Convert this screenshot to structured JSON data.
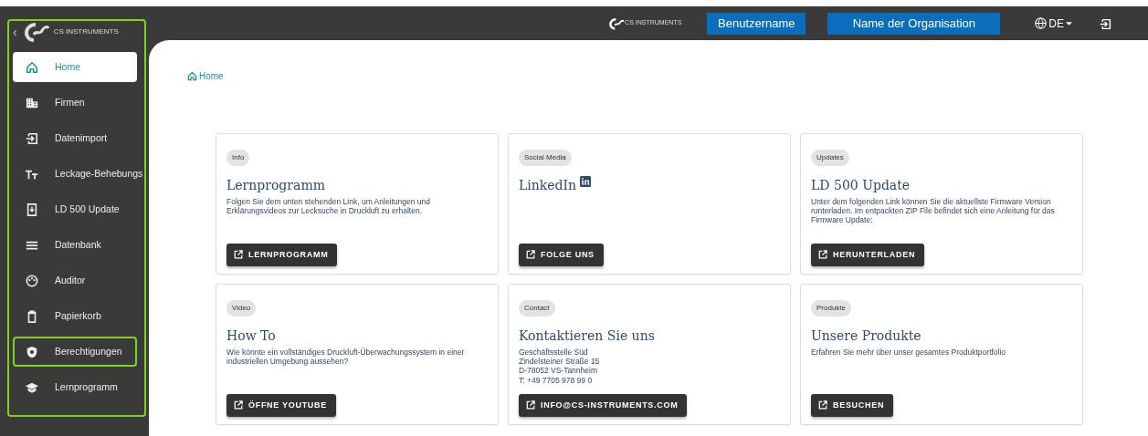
{
  "sidebar": {
    "collapse": "‹",
    "logo_text": "CS INSTRUMENTS",
    "highlighted": true,
    "items": [
      {
        "label": "Home",
        "selected": true,
        "highlighted": false
      },
      {
        "label": "Firmen",
        "selected": false,
        "highlighted": false
      },
      {
        "label": "Datenimport",
        "selected": false,
        "highlighted": false
      },
      {
        "label": "Leckage-Behebungs",
        "selected": false,
        "highlighted": false
      },
      {
        "label": "LD 500 Update",
        "selected": false,
        "highlighted": false
      },
      {
        "label": "Datenbank",
        "selected": false,
        "highlighted": false
      },
      {
        "label": "Auditor",
        "selected": false,
        "highlighted": false
      },
      {
        "label": "Papierkorb",
        "selected": false,
        "highlighted": false
      },
      {
        "label": "Berechtigungen",
        "selected": false,
        "highlighted": true
      },
      {
        "label": "Lernprogramm",
        "selected": false,
        "highlighted": false
      }
    ]
  },
  "topbar": {
    "logo_text": "CS INSTRUMENTS",
    "username": "Benutzername",
    "organisation": "Name der Organisation",
    "language": "DE"
  },
  "breadcrumb": "Home",
  "cards": [
    {
      "tag": "Info",
      "title": "Lernprogramm",
      "title_icon": false,
      "lines": [
        "Folgen Sie dem unten stehenden Link, um Anleitungen und Erklärungsvideos zur Lecksuche in Druckluft zu erhalten."
      ],
      "button": "LERNPROGRAMM"
    },
    {
      "tag": "Social Media",
      "title": "LinkedIn",
      "title_icon": true,
      "button": "FOLGE UNS"
    },
    {
      "tag": "Updates",
      "title": "LD 500 Update",
      "title_icon": false,
      "lines": [
        "Unter dem folgenden Link können Sie die aktuellste Firmware Version runterladen. Im entpackten ZIP File befindet sich eine Anleitung für das Firmware Update:"
      ],
      "button": "HERUNTERLADEN"
    },
    {
      "tag": "Video",
      "title": "How To",
      "title_icon": false,
      "lines": [
        "Wie könnte ein vollständiges Druckluft-Überwachungssystem in einer industriellen Umgebung aussehen?"
      ],
      "button": "ÖFFNE YOUTUBE"
    },
    {
      "tag": "Contact",
      "title": "Kontaktieren Sie uns",
      "title_icon": false,
      "lines": [
        "Geschäftsstelle Süd",
        "Zindelsteiner Straße 15",
        "D-78052 VS-Tannheim",
        "T: +49 7705 978 99 0"
      ],
      "button": "INFO@CS-INSTRUMENTS.COM"
    },
    {
      "tag": "Produkte",
      "title": "Unsere Produkte",
      "title_icon": false,
      "lines": [
        "Erfahren Sie mehr über unser gesamtes Produktportfolio"
      ],
      "button": "BESUCHEN"
    }
  ]
}
